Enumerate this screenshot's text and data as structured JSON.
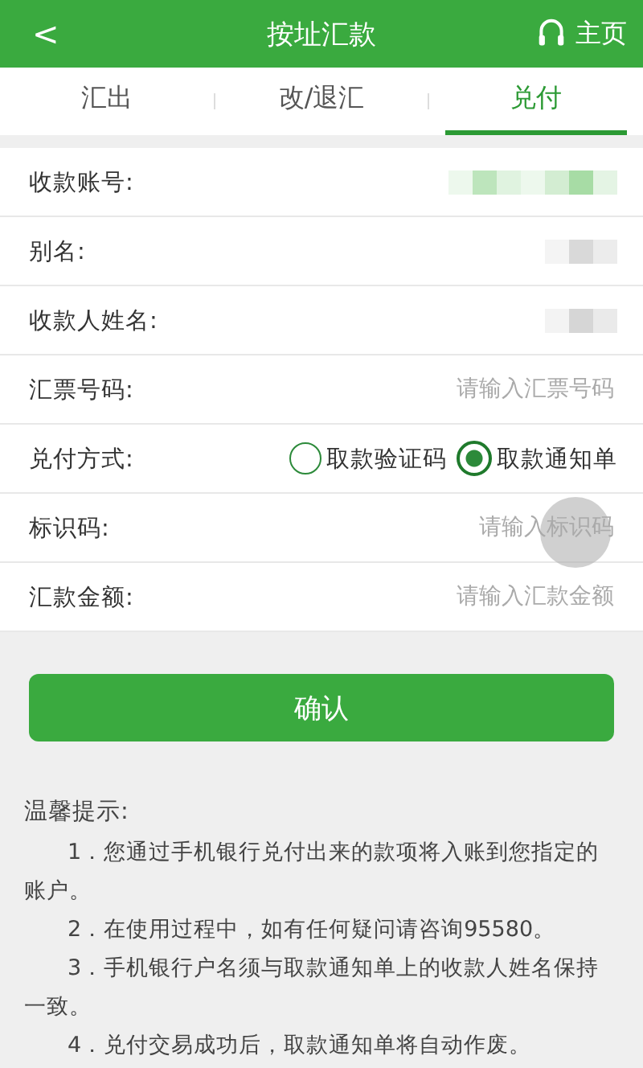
{
  "header": {
    "back": "<",
    "title": "按址汇款",
    "home": "主页"
  },
  "tabs": [
    {
      "label": "汇出",
      "selected": false
    },
    {
      "label": "改/退汇",
      "selected": false
    },
    {
      "label": "兑付",
      "selected": true
    }
  ],
  "form": [
    {
      "kind": "masked",
      "label": "收款账号:",
      "color": "#a7dca5"
    },
    {
      "kind": "masked",
      "label": "别名:",
      "color": "#d9d9d9"
    },
    {
      "kind": "masked",
      "label": "收款人姓名:",
      "color": "#d6d6d6"
    },
    {
      "kind": "input",
      "label": "汇票号码:",
      "placeholder": "请输入汇票号码"
    },
    {
      "kind": "radio",
      "label": "兑付方式:",
      "options": [
        {
          "label": "取款验证码",
          "selected": false
        },
        {
          "label": "取款通知单",
          "selected": true
        }
      ]
    },
    {
      "kind": "input",
      "label": "标识码:",
      "placeholder": "请输入标识码"
    },
    {
      "kind": "input",
      "label": "汇款金额:",
      "placeholder": "请输入汇款金额"
    }
  ],
  "confirm_button": "确认",
  "tips": {
    "title": "温馨提示:",
    "items": [
      "1．您通过手机银行兑付出来的款项将入账到您指定的账户。",
      "2．在使用过程中，如有任何疑问请咨询95580。",
      "3．手机银行户名须与取款通知单上的收款人姓名保持一致。",
      "4．兑付交易成功后，取款通知单将自动作废。"
    ]
  }
}
